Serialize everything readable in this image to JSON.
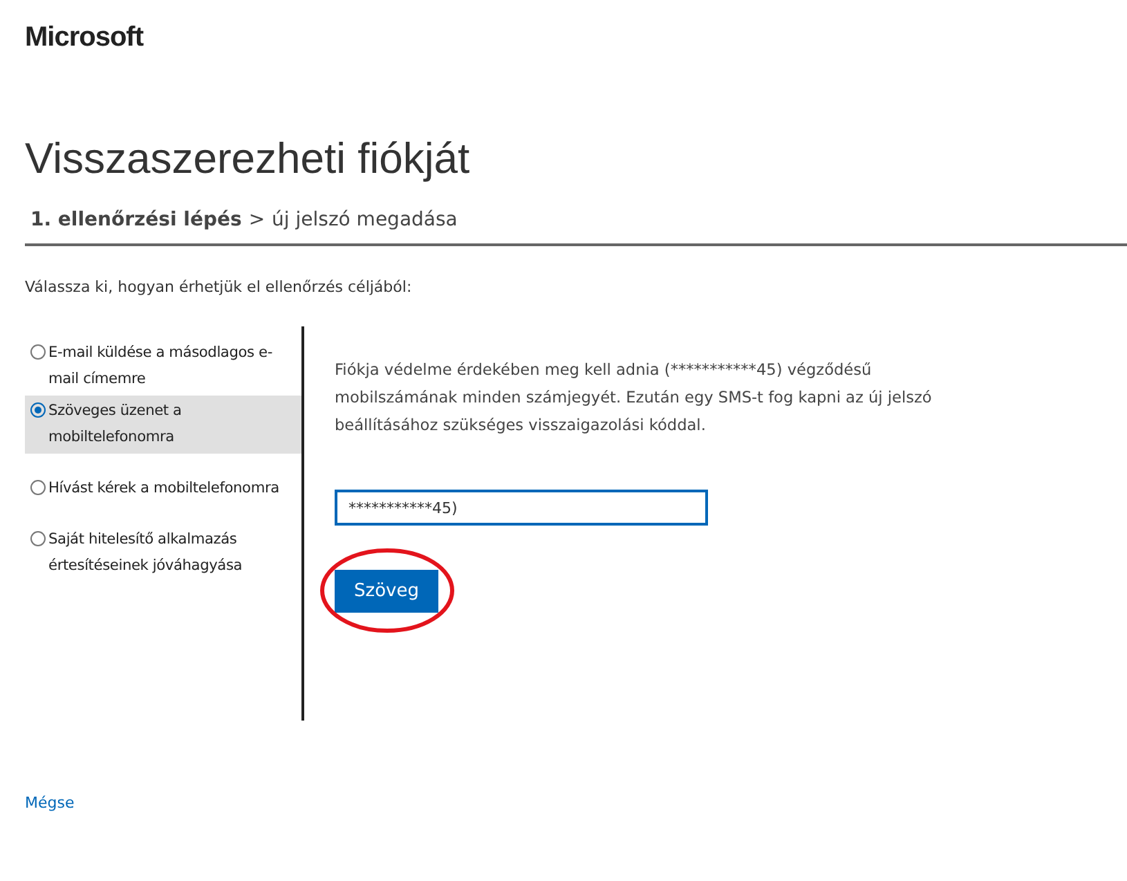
{
  "logo": "Microsoft",
  "title": "Visszaszerezheti fiókját",
  "steps": {
    "current": "1. ellenőrzési lépés",
    "separator": ">",
    "next": "új jelszó megadása"
  },
  "instruction": "Válassza ki, hogyan érhetjük el ellenőrzés céljából:",
  "options": [
    {
      "label": "E-mail küldése a másodlagos e-mail címemre",
      "selected": false
    },
    {
      "label": "Szöveges üzenet a mobiltelefonomra",
      "selected": true
    },
    {
      "label": "Hívást kérek a mobiltelefonomra",
      "selected": false
    },
    {
      "label": "Saját hitelesítő alkalmazás értesítéseinek jóváhagyása",
      "selected": false
    }
  ],
  "description": "Fiókja védelme érdekében meg kell adnia (***********45) végződésű mobilszámának minden számjegyét. Ezután egy SMS-t fog kapni az új jelszó beállításához szükséges visszaigazolási kóddal.",
  "phone_field": {
    "value": "***********45)"
  },
  "submit_button": {
    "label": "Szöveg",
    "circled": true
  },
  "cancel_link": "Mégse"
}
